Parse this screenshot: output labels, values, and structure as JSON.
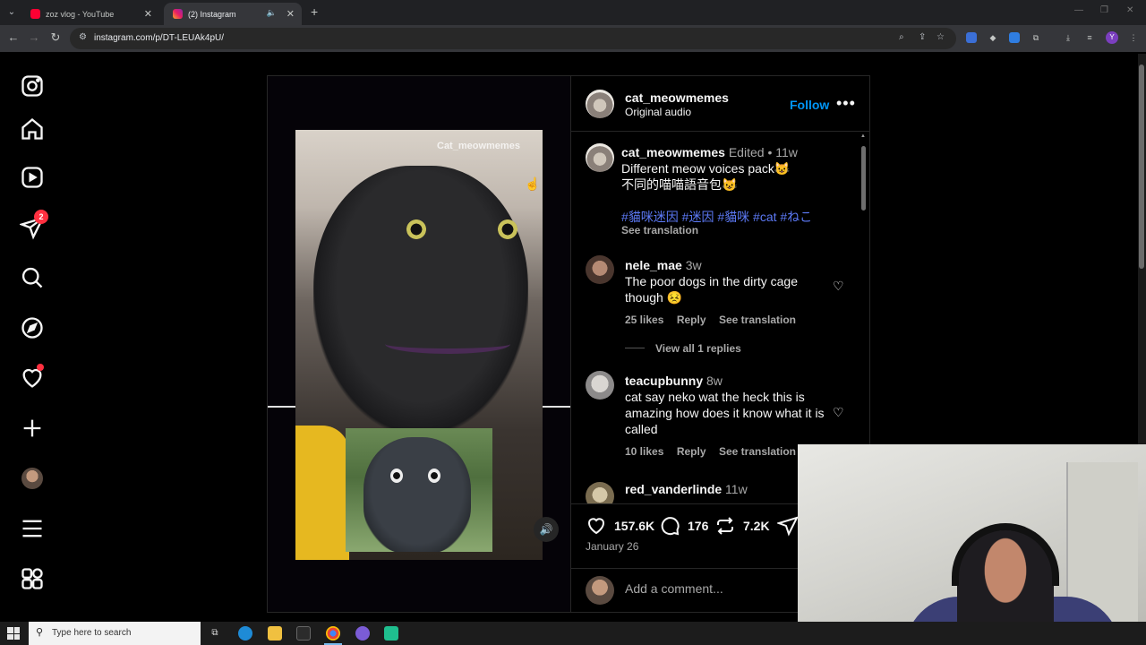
{
  "browser": {
    "tabs": [
      {
        "title": "zoz vlog - YouTube",
        "icon": "youtube-icon"
      },
      {
        "title": "(2) Instagram",
        "icon": "instagram-icon",
        "active": true
      }
    ],
    "url": "instagram.com/p/DT-LEUAk4pU/",
    "profile_initial": "Y"
  },
  "nav": {
    "notifications_badge": "2"
  },
  "video": {
    "watermark": "Cat_meowmemes"
  },
  "post": {
    "author": "cat_meowmemes",
    "audio": "Original audio",
    "follow_label": "Follow",
    "caption": {
      "username": "cat_meowmemes",
      "edited": "Edited",
      "separator": "•",
      "age": "11w",
      "line1": "Different meow voices pack😺",
      "line2": "不同的喵喵語音包😺",
      "hashtags": "#貓咪迷因 #迷因 #貓咪 #cat #ねこ",
      "see_translation": "See translation"
    },
    "comments": [
      {
        "username": "nele_mae",
        "age": "3w",
        "text": "The poor dogs in the dirty cage though 😣",
        "likes": "25 likes",
        "reply": "Reply",
        "translate": "See translation",
        "view_replies": "View all 1 replies"
      },
      {
        "username": "teacupbunny",
        "age": "8w",
        "text": "cat say neko wat the heck this is amazing how does it know what it is called",
        "likes": "10 likes",
        "reply": "Reply",
        "translate": "See translation"
      },
      {
        "username": "red_vanderlinde",
        "age": "11w"
      }
    ],
    "stats": {
      "likes": "157.6K",
      "comments": "176",
      "reposts": "7.2K"
    },
    "date": "January 26",
    "add_comment_placeholder": "Add a comment..."
  },
  "taskbar": {
    "search_placeholder": "Type here to search"
  },
  "colors": {
    "link_blue": "#0095f6",
    "hashtag_blue": "#5c79f5",
    "badge_red": "#ff3040"
  }
}
